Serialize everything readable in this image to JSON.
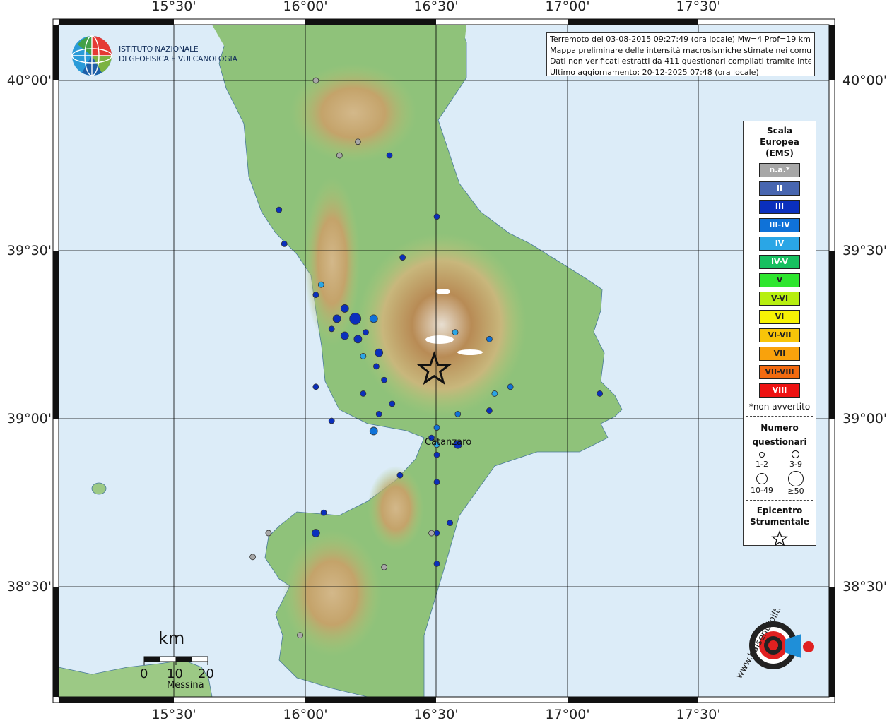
{
  "map": {
    "lon_ticks": [
      "15°30'",
      "16°00'",
      "16°30'",
      "17°00'",
      "17°30'"
    ],
    "lat_ticks": [
      "40°00'",
      "39°30'",
      "39°00'",
      "38°30'"
    ],
    "places": {
      "catanzaro": "Catanzaro",
      "messina": "Messina"
    },
    "colors": {
      "sea": "#dcecf8",
      "land_low": "#8fc27a",
      "land_mid": "#c9c890",
      "land_high": "#b58a52",
      "frame": "#111111",
      "grid": "#000000",
      "epicenter": "#111111"
    }
  },
  "info": {
    "line1": "Terremoto del 03-08-2015 09:27:49 (ora locale) Mw=4 Prof=19 km",
    "line2": "Mappa preliminare delle intensità macrosismiche stimate nei comuni",
    "line3": "Dati non verificati estratti da 411 questionari compilati tramite Internet.",
    "line4": "Ultimo aggiornamento: 20-12-2025 07:48 (ora locale)"
  },
  "logos": {
    "ingv_line1": "ISTITUTO NAZIONALE",
    "ingv_line2": "DI GEOFISICA E VULCANOLOGIA",
    "hst_text": "www.haisentitoilterremoto.it"
  },
  "scale": {
    "unit": "km",
    "labels": [
      "0",
      "10",
      "20"
    ]
  },
  "legend": {
    "title": "Scala\nEuropea\n(EMS)",
    "classes": [
      {
        "label": "n.a.*",
        "color": "#a7a7a7"
      },
      {
        "label": "II",
        "color": "#4866b0"
      },
      {
        "label": "III",
        "color": "#0a2fbd"
      },
      {
        "label": "III-IV",
        "color": "#0f72d8"
      },
      {
        "label": "IV",
        "color": "#2aa6e6"
      },
      {
        "label": "IV-V",
        "color": "#16c060"
      },
      {
        "label": "V",
        "color": "#2ee62e"
      },
      {
        "label": "V-VI",
        "color": "#b7ef10"
      },
      {
        "label": "VI",
        "color": "#f7f205"
      },
      {
        "label": "VI-VII",
        "color": "#f8c409"
      },
      {
        "label": "VII",
        "color": "#f9a20c"
      },
      {
        "label": "VII-VIII",
        "color": "#f26a10"
      },
      {
        "label": "VIII",
        "color": "#ee1212"
      }
    ],
    "note": "*non avvertito",
    "count_title": "Numero\nquestionari",
    "count_labels": [
      "1-2",
      "3-9",
      "10-49",
      "≥50"
    ],
    "epicenter_title": "Epicentro\nStrumentale"
  },
  "points": [
    {
      "lon": 16.04,
      "lat": 40.0,
      "i": "n.a.",
      "n": 1
    },
    {
      "lon": 16.2,
      "lat": 39.82,
      "i": "n.a.",
      "n": 1
    },
    {
      "lon": 16.13,
      "lat": 39.78,
      "i": "n.a.",
      "n": 2
    },
    {
      "lon": 16.32,
      "lat": 39.78,
      "i": "III",
      "n": 1
    },
    {
      "lon": 15.9,
      "lat": 39.62,
      "i": "III",
      "n": 2
    },
    {
      "lon": 15.92,
      "lat": 39.52,
      "i": "III",
      "n": 2
    },
    {
      "lon": 16.5,
      "lat": 39.6,
      "i": "III",
      "n": 2
    },
    {
      "lon": 16.37,
      "lat": 39.48,
      "i": "III",
      "n": 2
    },
    {
      "lon": 16.04,
      "lat": 39.37,
      "i": "III",
      "n": 2
    },
    {
      "lon": 16.15,
      "lat": 39.33,
      "i": "III",
      "n": 3
    },
    {
      "lon": 16.12,
      "lat": 39.3,
      "i": "III",
      "n": 3
    },
    {
      "lon": 16.19,
      "lat": 39.3,
      "i": "III",
      "n": 10
    },
    {
      "lon": 16.15,
      "lat": 39.25,
      "i": "III",
      "n": 3
    },
    {
      "lon": 16.2,
      "lat": 39.24,
      "i": "III",
      "n": 3
    },
    {
      "lon": 16.26,
      "lat": 39.3,
      "i": "III-IV",
      "n": 3
    },
    {
      "lon": 16.23,
      "lat": 39.26,
      "i": "III",
      "n": 2
    },
    {
      "lon": 16.28,
      "lat": 39.2,
      "i": "III",
      "n": 3
    },
    {
      "lon": 16.27,
      "lat": 39.16,
      "i": "III",
      "n": 2
    },
    {
      "lon": 16.1,
      "lat": 39.27,
      "i": "III",
      "n": 2
    },
    {
      "lon": 16.22,
      "lat": 39.19,
      "i": "IV",
      "n": 2
    },
    {
      "lon": 16.3,
      "lat": 39.12,
      "i": "III",
      "n": 2
    },
    {
      "lon": 16.04,
      "lat": 39.1,
      "i": "III",
      "n": 2
    },
    {
      "lon": 16.22,
      "lat": 39.08,
      "i": "III",
      "n": 1
    },
    {
      "lon": 16.33,
      "lat": 39.05,
      "i": "III",
      "n": 2
    },
    {
      "lon": 16.28,
      "lat": 39.02,
      "i": "III",
      "n": 2
    },
    {
      "lon": 16.1,
      "lat": 39.0,
      "i": "III",
      "n": 2
    },
    {
      "lon": 16.26,
      "lat": 38.97,
      "i": "III-IV",
      "n": 3
    },
    {
      "lon": 16.5,
      "lat": 38.98,
      "i": "III-IV",
      "n": 2
    },
    {
      "lon": 16.48,
      "lat": 38.95,
      "i": "III",
      "n": 2
    },
    {
      "lon": 16.58,
      "lat": 38.93,
      "i": "III",
      "n": 3
    },
    {
      "lon": 16.5,
      "lat": 38.93,
      "i": "IV",
      "n": 2
    },
    {
      "lon": 16.58,
      "lat": 39.02,
      "i": "III-IV",
      "n": 2
    },
    {
      "lon": 16.7,
      "lat": 39.03,
      "i": "III",
      "n": 2
    },
    {
      "lon": 16.72,
      "lat": 39.08,
      "i": "IV",
      "n": 2
    },
    {
      "lon": 16.78,
      "lat": 39.1,
      "i": "III-IV",
      "n": 1
    },
    {
      "lon": 16.7,
      "lat": 39.24,
      "i": "III-IV",
      "n": 2
    },
    {
      "lon": 16.57,
      "lat": 39.26,
      "i": "IV",
      "n": 2
    },
    {
      "lon": 17.12,
      "lat": 39.08,
      "i": "III",
      "n": 2
    },
    {
      "lon": 16.06,
      "lat": 39.4,
      "i": "IV",
      "n": 2
    },
    {
      "lon": 16.5,
      "lat": 38.9,
      "i": "III",
      "n": 2
    },
    {
      "lon": 16.5,
      "lat": 38.82,
      "i": "III",
      "n": 2
    },
    {
      "lon": 16.36,
      "lat": 38.84,
      "i": "III",
      "n": 2
    },
    {
      "lon": 16.55,
      "lat": 38.7,
      "i": "III",
      "n": 2
    },
    {
      "lon": 16.5,
      "lat": 38.67,
      "i": "III",
      "n": 2
    },
    {
      "lon": 16.07,
      "lat": 38.73,
      "i": "III",
      "n": 2
    },
    {
      "lon": 16.04,
      "lat": 38.67,
      "i": "III",
      "n": 3
    },
    {
      "lon": 16.3,
      "lat": 38.57,
      "i": "n.a.",
      "n": 2
    },
    {
      "lon": 16.48,
      "lat": 38.67,
      "i": "n.a.",
      "n": 2
    },
    {
      "lon": 15.86,
      "lat": 38.67,
      "i": "n.a.",
      "n": 1
    },
    {
      "lon": 15.8,
      "lat": 38.6,
      "i": "n.a.",
      "n": 1
    },
    {
      "lon": 16.5,
      "lat": 38.58,
      "i": "III",
      "n": 1
    },
    {
      "lon": 15.98,
      "lat": 38.37,
      "i": "n.a.",
      "n": 1
    }
  ],
  "epicenter": {
    "lon": 16.49,
    "lat": 39.15
  }
}
